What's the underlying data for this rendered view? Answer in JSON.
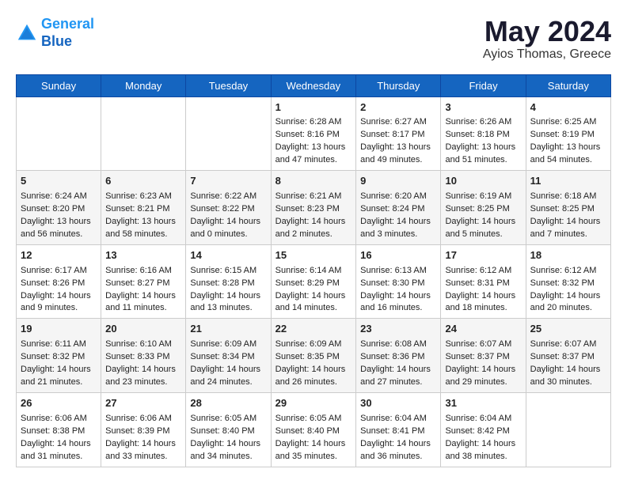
{
  "header": {
    "logo_line1": "General",
    "logo_line2": "Blue",
    "month": "May 2024",
    "location": "Ayios Thomas, Greece"
  },
  "days_of_week": [
    "Sunday",
    "Monday",
    "Tuesday",
    "Wednesday",
    "Thursday",
    "Friday",
    "Saturday"
  ],
  "weeks": [
    [
      {
        "day": "",
        "data": ""
      },
      {
        "day": "",
        "data": ""
      },
      {
        "day": "",
        "data": ""
      },
      {
        "day": "1",
        "data": "Sunrise: 6:28 AM\nSunset: 8:16 PM\nDaylight: 13 hours\nand 47 minutes."
      },
      {
        "day": "2",
        "data": "Sunrise: 6:27 AM\nSunset: 8:17 PM\nDaylight: 13 hours\nand 49 minutes."
      },
      {
        "day": "3",
        "data": "Sunrise: 6:26 AM\nSunset: 8:18 PM\nDaylight: 13 hours\nand 51 minutes."
      },
      {
        "day": "4",
        "data": "Sunrise: 6:25 AM\nSunset: 8:19 PM\nDaylight: 13 hours\nand 54 minutes."
      }
    ],
    [
      {
        "day": "5",
        "data": "Sunrise: 6:24 AM\nSunset: 8:20 PM\nDaylight: 13 hours\nand 56 minutes."
      },
      {
        "day": "6",
        "data": "Sunrise: 6:23 AM\nSunset: 8:21 PM\nDaylight: 13 hours\nand 58 minutes."
      },
      {
        "day": "7",
        "data": "Sunrise: 6:22 AM\nSunset: 8:22 PM\nDaylight: 14 hours\nand 0 minutes."
      },
      {
        "day": "8",
        "data": "Sunrise: 6:21 AM\nSunset: 8:23 PM\nDaylight: 14 hours\nand 2 minutes."
      },
      {
        "day": "9",
        "data": "Sunrise: 6:20 AM\nSunset: 8:24 PM\nDaylight: 14 hours\nand 3 minutes."
      },
      {
        "day": "10",
        "data": "Sunrise: 6:19 AM\nSunset: 8:25 PM\nDaylight: 14 hours\nand 5 minutes."
      },
      {
        "day": "11",
        "data": "Sunrise: 6:18 AM\nSunset: 8:25 PM\nDaylight: 14 hours\nand 7 minutes."
      }
    ],
    [
      {
        "day": "12",
        "data": "Sunrise: 6:17 AM\nSunset: 8:26 PM\nDaylight: 14 hours\nand 9 minutes."
      },
      {
        "day": "13",
        "data": "Sunrise: 6:16 AM\nSunset: 8:27 PM\nDaylight: 14 hours\nand 11 minutes."
      },
      {
        "day": "14",
        "data": "Sunrise: 6:15 AM\nSunset: 8:28 PM\nDaylight: 14 hours\nand 13 minutes."
      },
      {
        "day": "15",
        "data": "Sunrise: 6:14 AM\nSunset: 8:29 PM\nDaylight: 14 hours\nand 14 minutes."
      },
      {
        "day": "16",
        "data": "Sunrise: 6:13 AM\nSunset: 8:30 PM\nDaylight: 14 hours\nand 16 minutes."
      },
      {
        "day": "17",
        "data": "Sunrise: 6:12 AM\nSunset: 8:31 PM\nDaylight: 14 hours\nand 18 minutes."
      },
      {
        "day": "18",
        "data": "Sunrise: 6:12 AM\nSunset: 8:32 PM\nDaylight: 14 hours\nand 20 minutes."
      }
    ],
    [
      {
        "day": "19",
        "data": "Sunrise: 6:11 AM\nSunset: 8:32 PM\nDaylight: 14 hours\nand 21 minutes."
      },
      {
        "day": "20",
        "data": "Sunrise: 6:10 AM\nSunset: 8:33 PM\nDaylight: 14 hours\nand 23 minutes."
      },
      {
        "day": "21",
        "data": "Sunrise: 6:09 AM\nSunset: 8:34 PM\nDaylight: 14 hours\nand 24 minutes."
      },
      {
        "day": "22",
        "data": "Sunrise: 6:09 AM\nSunset: 8:35 PM\nDaylight: 14 hours\nand 26 minutes."
      },
      {
        "day": "23",
        "data": "Sunrise: 6:08 AM\nSunset: 8:36 PM\nDaylight: 14 hours\nand 27 minutes."
      },
      {
        "day": "24",
        "data": "Sunrise: 6:07 AM\nSunset: 8:37 PM\nDaylight: 14 hours\nand 29 minutes."
      },
      {
        "day": "25",
        "data": "Sunrise: 6:07 AM\nSunset: 8:37 PM\nDaylight: 14 hours\nand 30 minutes."
      }
    ],
    [
      {
        "day": "26",
        "data": "Sunrise: 6:06 AM\nSunset: 8:38 PM\nDaylight: 14 hours\nand 31 minutes."
      },
      {
        "day": "27",
        "data": "Sunrise: 6:06 AM\nSunset: 8:39 PM\nDaylight: 14 hours\nand 33 minutes."
      },
      {
        "day": "28",
        "data": "Sunrise: 6:05 AM\nSunset: 8:40 PM\nDaylight: 14 hours\nand 34 minutes."
      },
      {
        "day": "29",
        "data": "Sunrise: 6:05 AM\nSunset: 8:40 PM\nDaylight: 14 hours\nand 35 minutes."
      },
      {
        "day": "30",
        "data": "Sunrise: 6:04 AM\nSunset: 8:41 PM\nDaylight: 14 hours\nand 36 minutes."
      },
      {
        "day": "31",
        "data": "Sunrise: 6:04 AM\nSunset: 8:42 PM\nDaylight: 14 hours\nand 38 minutes."
      },
      {
        "day": "",
        "data": ""
      }
    ]
  ]
}
